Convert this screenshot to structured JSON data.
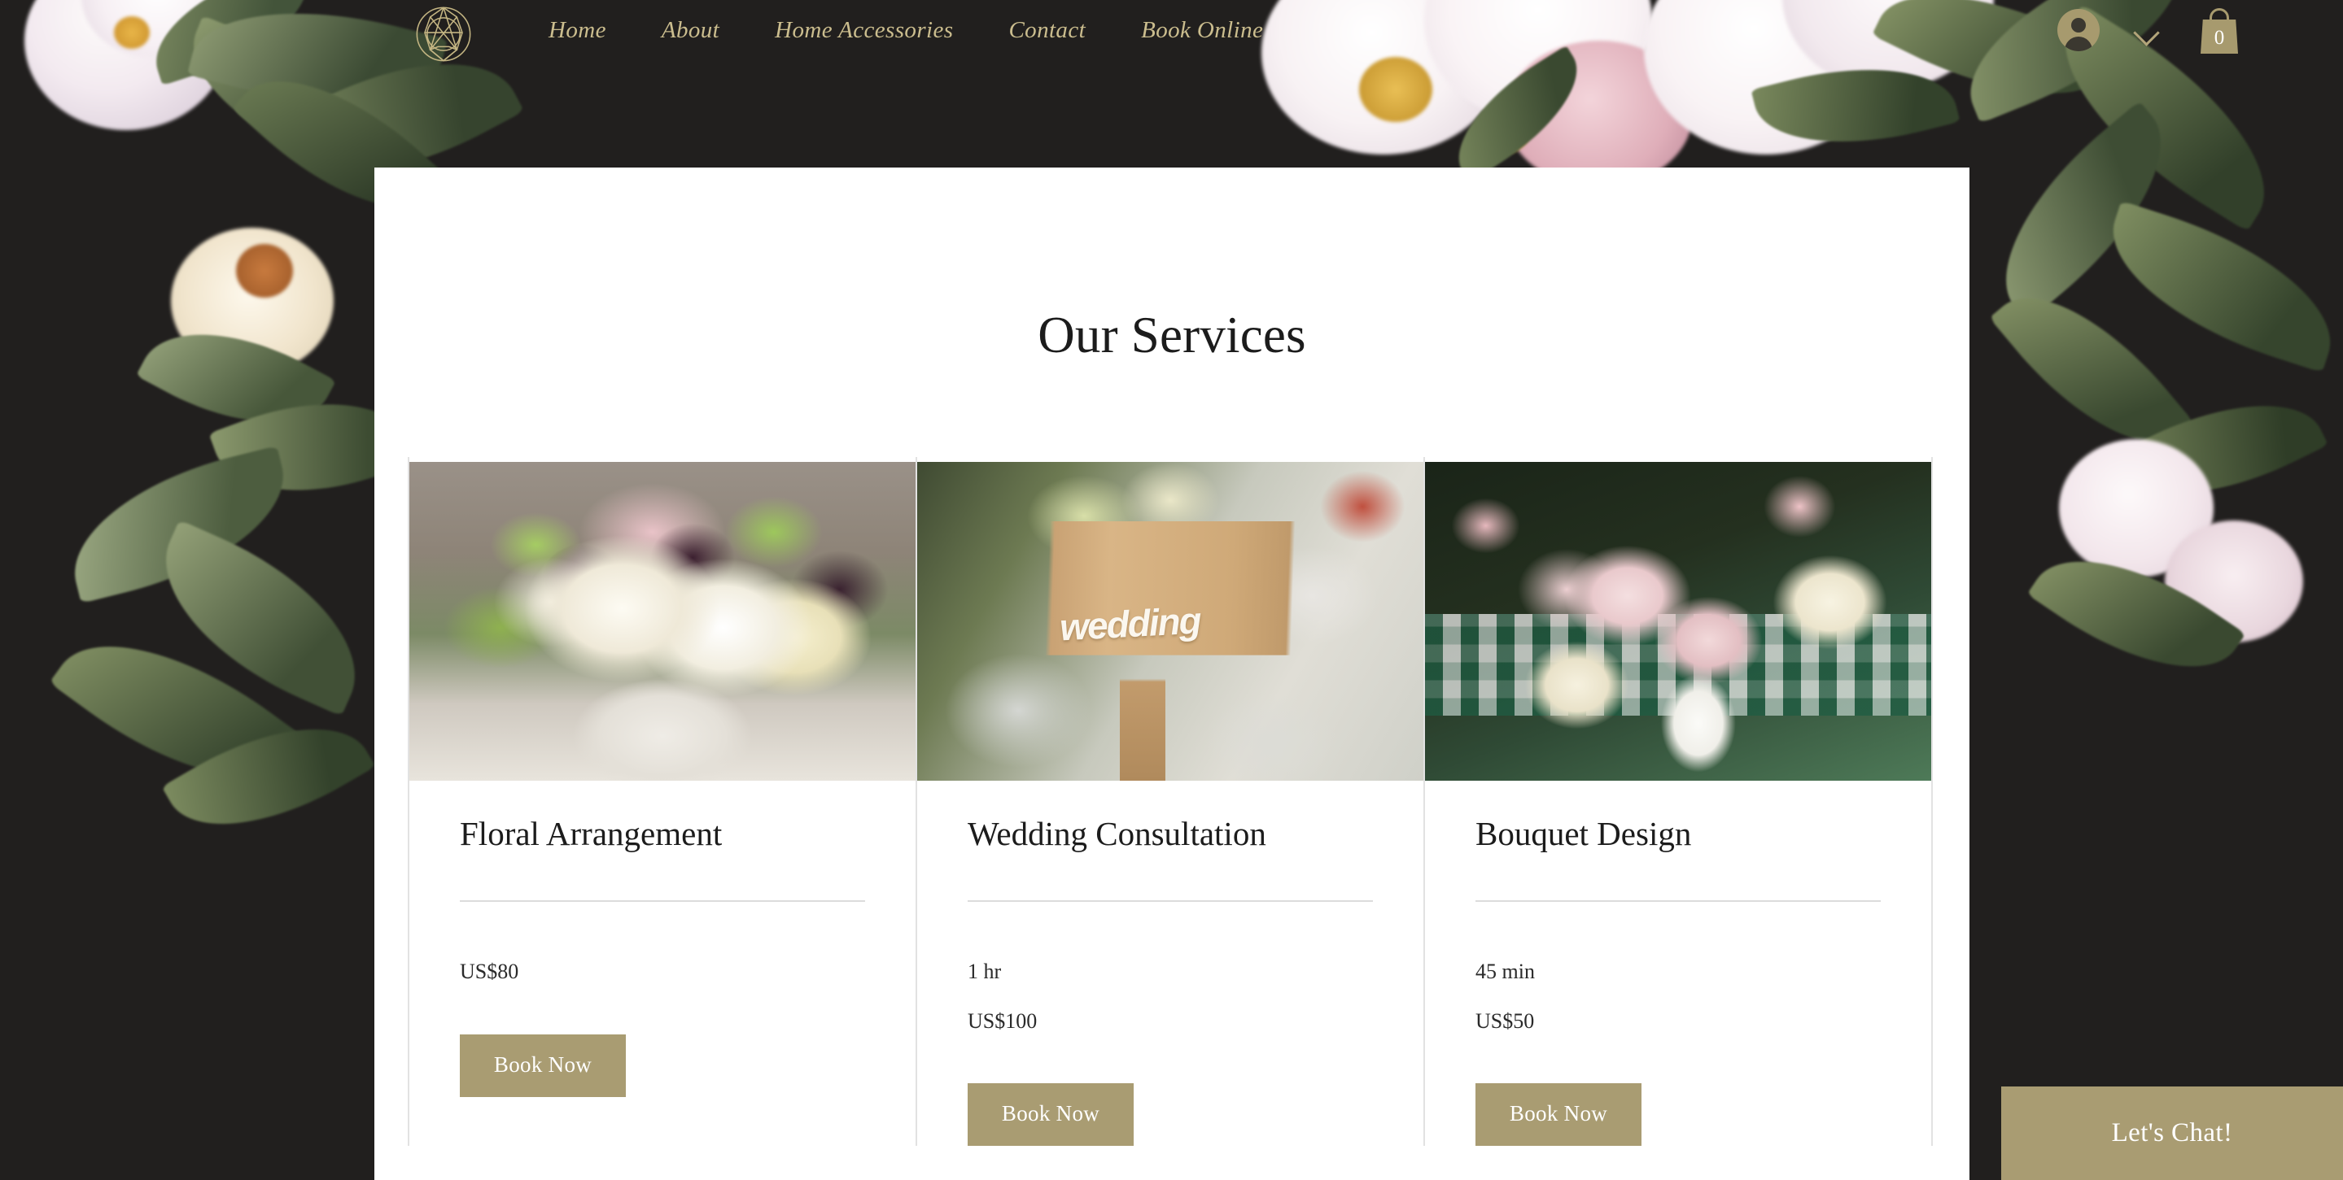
{
  "header": {
    "logo_icon": "gem-circle-logo-icon",
    "nav": [
      {
        "label": "Home"
      },
      {
        "label": "About"
      },
      {
        "label": "Home Accessories"
      },
      {
        "label": "Contact"
      },
      {
        "label": "Book Online"
      }
    ],
    "account_icon": "user-avatar-icon",
    "language_icon": "chevron-down-icon",
    "cart_icon": "shopping-bag-icon",
    "cart_count": "0"
  },
  "main": {
    "section_title": "Our Services",
    "services": [
      {
        "title": "Floral Arrangement",
        "image_alt": "floral-arrangement-in-white-urn-photo",
        "duration": "",
        "price": "US$80",
        "button_label": "Book Now"
      },
      {
        "title": "Wedding Consultation",
        "image_alt": "wooden-wedding-sign-photo",
        "duration": "1 hr",
        "price": "US$100",
        "button_label": "Book Now"
      },
      {
        "title": "Bouquet Design",
        "image_alt": "pink-peonies-in-white-vase-photo",
        "duration": "45 min",
        "price": "US$50",
        "button_label": "Book Now"
      }
    ]
  },
  "chat": {
    "label": "Let's Chat!"
  },
  "colors": {
    "page_background": "#211f1e",
    "panel_background": "#ffffff",
    "accent_gold": "#a99c72",
    "nav_gold": "#cbbd8e",
    "text_dark": "#1c1c1c",
    "divider": "#e2e2e2"
  }
}
